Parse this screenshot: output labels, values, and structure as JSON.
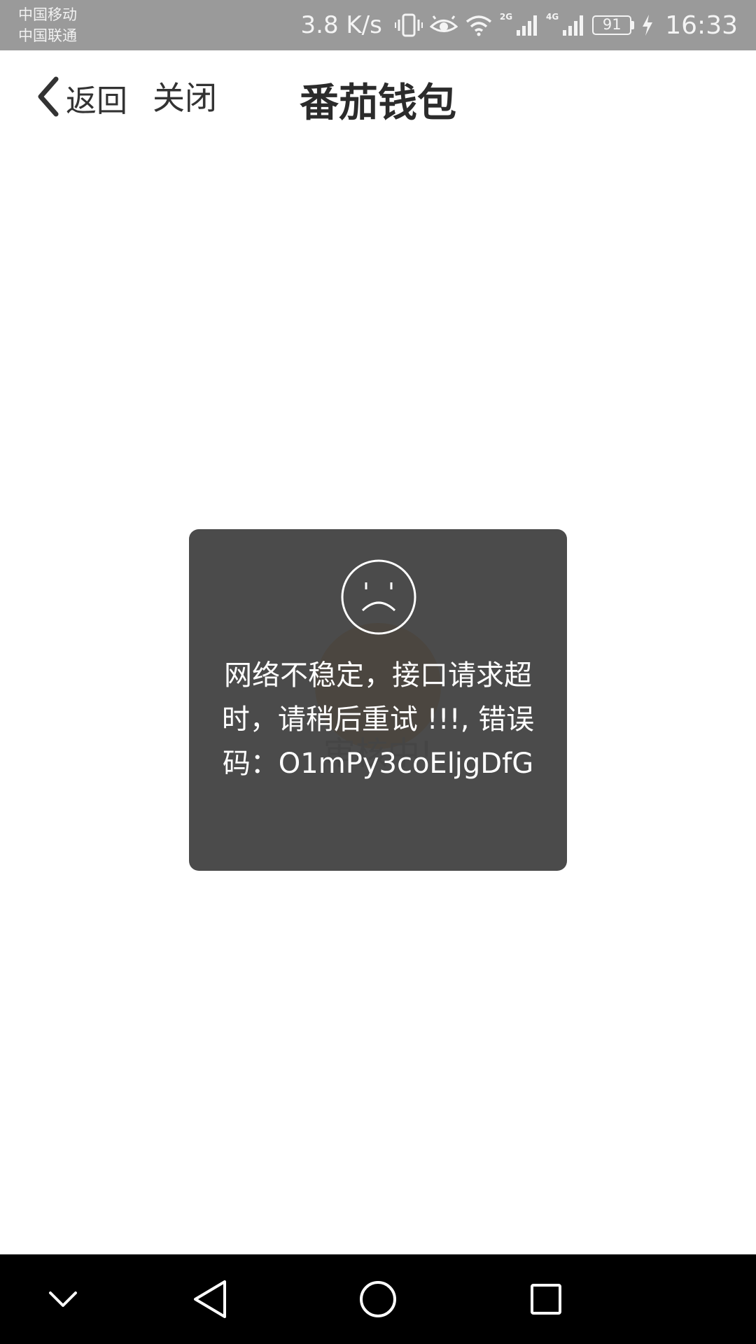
{
  "status_bar": {
    "carrier_1": "中国移动",
    "carrier_2": "中国联通",
    "net_speed": "3.8 K/s",
    "net_tag_1": "2G",
    "net_tag_2": "4G",
    "battery_level": "91",
    "time": "16:33",
    "icons": [
      "vibrate-icon",
      "eye-comfort-icon",
      "wifi-icon",
      "signal-icon",
      "battery-icon",
      "charging-icon"
    ]
  },
  "header": {
    "back_label": "返回",
    "close_label": "关闭",
    "title": "番茄钱包"
  },
  "main": {
    "pending_text": "审核中!"
  },
  "toast": {
    "icon": "sad-face-icon",
    "message": "网络不稳定，接口请求超时，请稍后重试 !!!, 错误码：O1mPy3coEljgDfG"
  },
  "nav_bar": {
    "icons": [
      "collapse-icon",
      "back-triangle-icon",
      "home-circle-icon",
      "recents-square-icon"
    ]
  },
  "colors": {
    "status_bar_bg": "#9a9a9a",
    "toast_bg": "#404040",
    "pending_accent": "#f0a640",
    "nav_bar_bg": "#000000"
  }
}
